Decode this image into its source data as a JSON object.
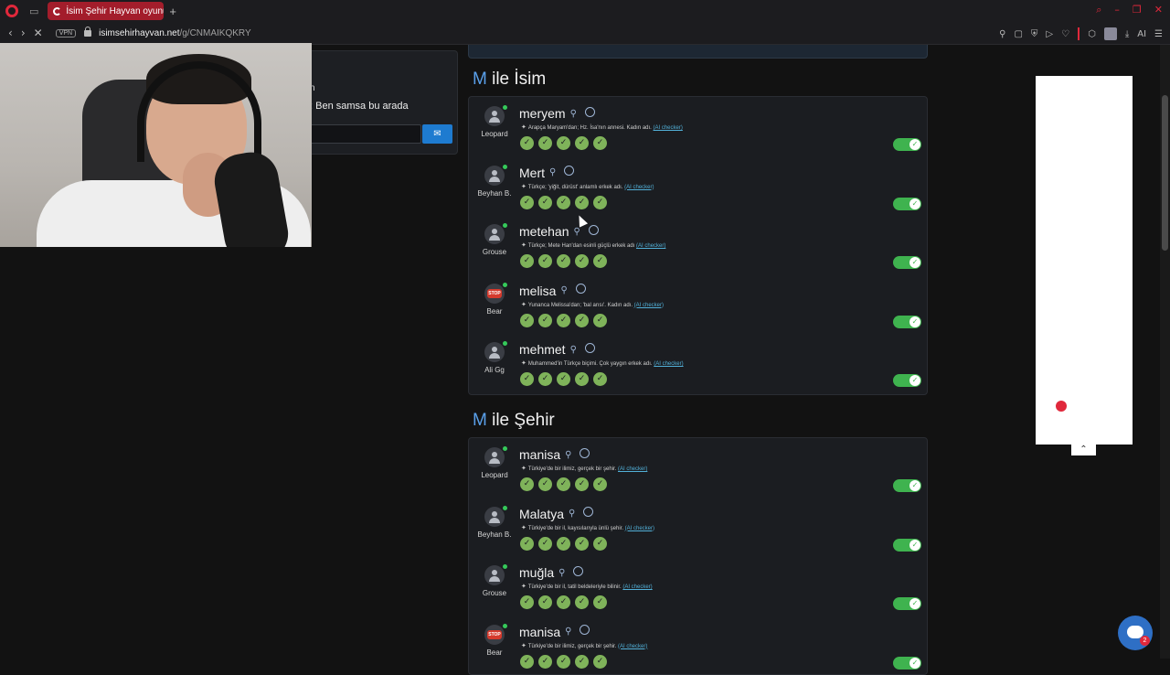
{
  "browser": {
    "tab_title": "İsim Şehir Hayvan oyunun",
    "new_tab": "+",
    "vpn": "VPN",
    "url_host": "isimsehirhayvan.net",
    "url_path": "/g/CNMAIKQKRY",
    "ai_label": "AI"
  },
  "chat": {
    "message_partial": "n",
    "message": ": Ben samsa bu arada"
  },
  "sections": [
    {
      "letter": "M",
      "title": " ile İsim",
      "entries": [
        {
          "player": "Leopard",
          "word": "meryem",
          "desc": "Arapça Maryam'dan; Hz. İsa'nın annesi. Kadın adı.",
          "avatar": "person"
        },
        {
          "player": "Beyhan B.",
          "word": "Mert",
          "desc": "Türkçe; 'yiğit, dürüst' anlamlı erkek adı.",
          "avatar": "person"
        },
        {
          "player": "Grouse",
          "word": "metehan",
          "desc": "Türkçe; Mete Han'dan esinli güçlü erkek adı",
          "avatar": "person"
        },
        {
          "player": "Bear",
          "word": "melisa",
          "desc": "Yunanca Melissa'dan; 'bal arısı'. Kadın adı.",
          "avatar": "stop"
        },
        {
          "player": "Ali Gg",
          "word": "mehmet",
          "desc": "Muhammed'in Türkçe biçimi. Çok yaygın erkek adı.",
          "avatar": "person"
        }
      ]
    },
    {
      "letter": "M",
      "title": " ile Şehir",
      "entries": [
        {
          "player": "Leopard",
          "word": "manisa",
          "desc": "Türkiye'de bir ilimiz, gerçek bir şehir.",
          "avatar": "person"
        },
        {
          "player": "Beyhan B.",
          "word": "Malatya",
          "desc": "Türkiye'de bir il, kayısılarıyla ünlü şehir.",
          "avatar": "person"
        },
        {
          "player": "Grouse",
          "word": "muğla",
          "desc": "Türkiye'de bir il, tatil beldeleriyle bilinir.",
          "avatar": "person"
        },
        {
          "player": "Bear",
          "word": "manisa",
          "desc": "Türkiye'de bir ilimiz, gerçek bir şehir.",
          "avatar": "stop"
        }
      ]
    }
  ],
  "ai_checker_label": "(AI checker)",
  "stop_sign": "STOP",
  "chat_badge": "2",
  "colors": {
    "accent_letter": "#5aa0ea",
    "check_green": "#7fb35a",
    "toggle_green": "#3fb34f",
    "brand_red": "#e0283b"
  }
}
